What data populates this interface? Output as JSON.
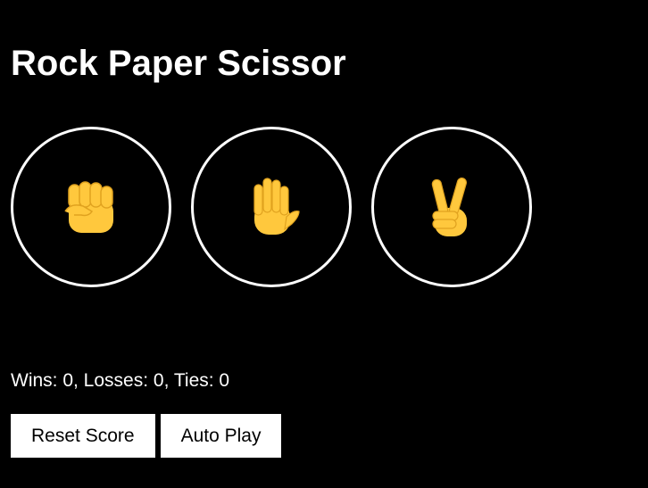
{
  "app": {
    "title": "Rock Paper Scissor"
  },
  "moves": [
    {
      "name": "rock",
      "icon": "raised-fist-icon"
    },
    {
      "name": "paper",
      "icon": "raised-hand-icon"
    },
    {
      "name": "scissors",
      "icon": "victory-hand-icon"
    }
  ],
  "score": {
    "text": "Wins: 0, Losses: 0, Ties: 0",
    "wins": 0,
    "losses": 0,
    "ties": 0
  },
  "controls": {
    "reset_label": "Reset Score",
    "autoplay_label": "Auto Play"
  },
  "colors": {
    "background": "#000000",
    "foreground": "#ffffff",
    "emoji_skin": "#FFC83D",
    "emoji_shade": "#E0A21F"
  }
}
